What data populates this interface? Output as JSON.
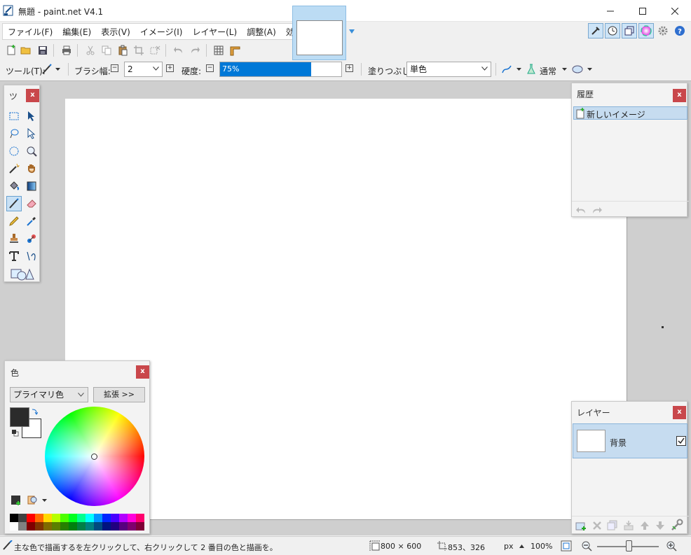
{
  "window": {
    "title": "無題 - paint.net V4.1"
  },
  "menu": [
    "ファイル(F)",
    "編集(E)",
    "表示(V)",
    "イメージ(I)",
    "レイヤー(L)",
    "調整(A)",
    "効果(C)"
  ],
  "right_toolbar_icons": [
    "tools-window-icon",
    "history-window-icon",
    "layers-window-icon",
    "colors-window-icon",
    "settings-icon",
    "help-icon"
  ],
  "options": {
    "tool_label": "ツール(T):",
    "brush_width_label": "ブラシ幅:",
    "brush_width_value": "2",
    "hardness_label": "硬度:",
    "hardness_value": "75%",
    "hardness_percent": 75,
    "fill_label": "塗りつぶし:",
    "fill_value": "単色",
    "blend_mode": "通常"
  },
  "tools_panel": {
    "title": "ツ",
    "close": "x"
  },
  "history_panel": {
    "title": "履歴",
    "close": "x",
    "items": [
      "新しいイメージ"
    ]
  },
  "layers_panel": {
    "title": "レイヤー",
    "close": "x",
    "layers": [
      {
        "name": "背景",
        "visible": true
      }
    ]
  },
  "colors_panel": {
    "title": "色",
    "close": "x",
    "mode": "プライマリ色",
    "expand_label": "拡張 >>",
    "primary_color": "#2b2b2b",
    "secondary_color": "#ffffff"
  },
  "status": {
    "hint": "主な色で描画するを左クリックして、右クリックして 2 番目の色と描画を。",
    "image_size": "800 × 600",
    "cursor_pos": "853、326",
    "unit": "px",
    "zoom": "100%"
  },
  "colors": {
    "accent": "#0078d7",
    "selection": "#c6dcf0",
    "close_red": "#c9474b"
  }
}
